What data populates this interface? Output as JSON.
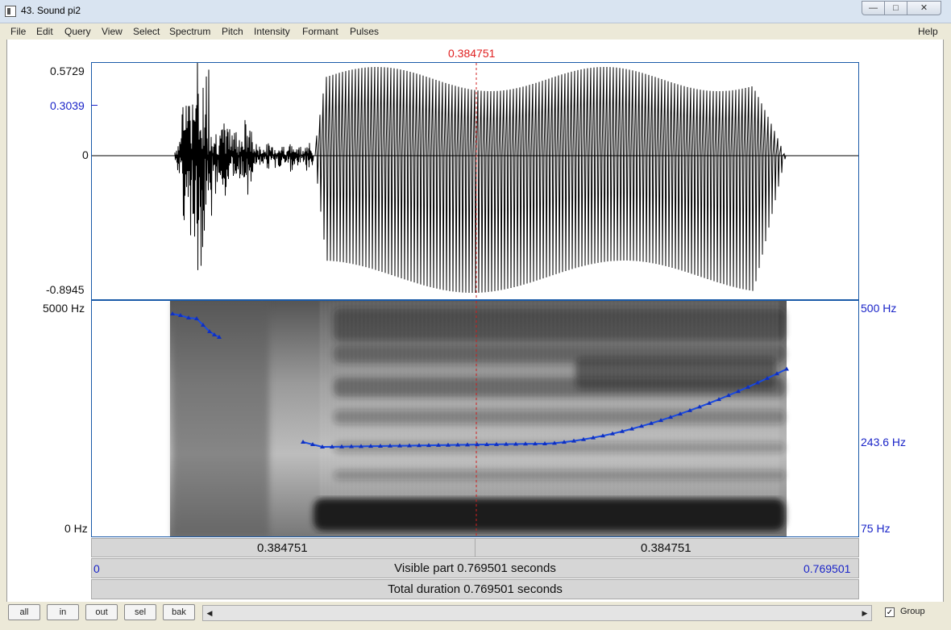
{
  "window": {
    "title": "43. Sound pi2"
  },
  "menu": {
    "items": [
      "File",
      "Edit",
      "Query",
      "View",
      "Select",
      "Spectrum",
      "Pitch",
      "Intensity",
      "Formant",
      "Pulses"
    ],
    "help": "Help"
  },
  "cursor": {
    "time_label": "0.384751"
  },
  "waveform": {
    "y_max": "0.5729",
    "y_mark": "0.3039",
    "y_zero": "0",
    "y_min": "-0.8945"
  },
  "spectrogram": {
    "freq_max": "5000 Hz",
    "freq_min": "0 Hz"
  },
  "pitch": {
    "max": "500 Hz",
    "mark": "243.6 Hz",
    "min": "75 Hz"
  },
  "time_bars": {
    "left_segment": "0.384751",
    "right_segment": "0.384751",
    "visible_start": "0",
    "visible_end": "0.769501",
    "visible_part": "Visible part 0.769501 seconds",
    "total_duration": "Total duration 0.769501 seconds"
  },
  "toolbar": {
    "buttons": [
      "all",
      "in",
      "out",
      "sel",
      "bak"
    ],
    "group_label": "Group",
    "group_checked": true
  },
  "colors": {
    "accent_blue": "#1a24c8",
    "cursor_red": "#e02020",
    "pitch_line": "#1a4ae0"
  }
}
